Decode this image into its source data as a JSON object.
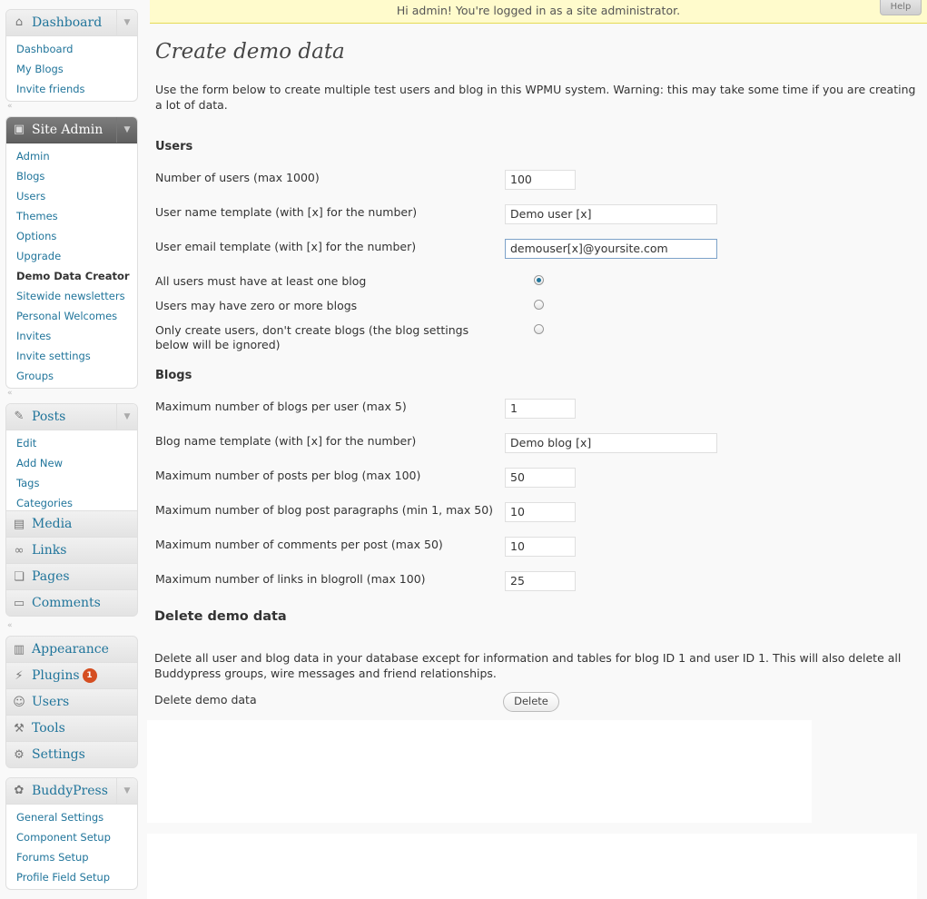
{
  "topbar": {
    "message": "Hi admin! You're logged in as a site administrator.",
    "help": "Help"
  },
  "sidebar": {
    "dashboard": {
      "title": "Dashboard",
      "items": [
        "Dashboard",
        "My Blogs",
        "Invite friends"
      ]
    },
    "site_admin": {
      "title": "Site Admin",
      "items": [
        "Admin",
        "Blogs",
        "Users",
        "Themes",
        "Options",
        "Upgrade",
        "Demo Data Creator",
        "Sitewide newsletters",
        "Personal Welcomes",
        "Invites",
        "Invite settings",
        "Groups"
      ]
    },
    "posts": {
      "title": "Posts",
      "items": [
        "Edit",
        "Add New",
        "Tags",
        "Categories"
      ]
    },
    "media": "Media",
    "links": "Links",
    "pages": "Pages",
    "comments": "Comments",
    "appearance": "Appearance",
    "plugins": "Plugins",
    "plugins_badge": "1",
    "users": "Users",
    "tools": "Tools",
    "settings": "Settings",
    "buddypress": {
      "title": "BuddyPress",
      "items": [
        "General Settings",
        "Component Setup",
        "Forums Setup",
        "Profile Field Setup"
      ]
    }
  },
  "main": {
    "title": "Create demo data",
    "intro": "Use the form below to create multiple test users and blog in this WPMU system. Warning: this may take some time if you are creating a lot of data.",
    "users_heading": "Users",
    "num_users_label": "Number of users (max 1000)",
    "num_users_value": "100",
    "user_name_label": "User name template (with [x] for the number)",
    "user_name_value": "Demo user [x]",
    "user_email_label": "User email template (with [x] for the number)",
    "user_email_value": "demouser[x]@yoursite.com",
    "radio1_label": "All users must have at least one blog",
    "radio2_label": "Users may have zero or more blogs",
    "radio3_label_line1": "Only create users, don't create blogs (the blog settings",
    "radio3_label_line2": "below will be ignored)",
    "blogs_heading": "Blogs",
    "max_blogs_label": "Maximum number of blogs per user (max 5)",
    "max_blogs_value": "1",
    "blog_name_label": "Blog name template (with [x] for the number)",
    "blog_name_value": "Demo blog [x]",
    "max_posts_label": "Maximum number of posts per blog (max 100)",
    "max_posts_value": "50",
    "max_paragraphs_label": "Maximum number of blog post paragraphs (min 1, max 50)",
    "max_paragraphs_value": "10",
    "max_comments_label": "Maximum number of comments per post (max 50)",
    "max_comments_value": "10",
    "max_links_label": "Maximum number of links in blogroll (max 100)",
    "max_links_value": "25",
    "delete_heading": "Delete demo data",
    "delete_desc": "Delete all user and blog data in your database except for information and tables for blog ID 1 and user ID 1. This will also delete all Buddypress groups, wire messages and friend relationships.",
    "delete_label": "Delete demo data",
    "delete_button": "Delete"
  }
}
